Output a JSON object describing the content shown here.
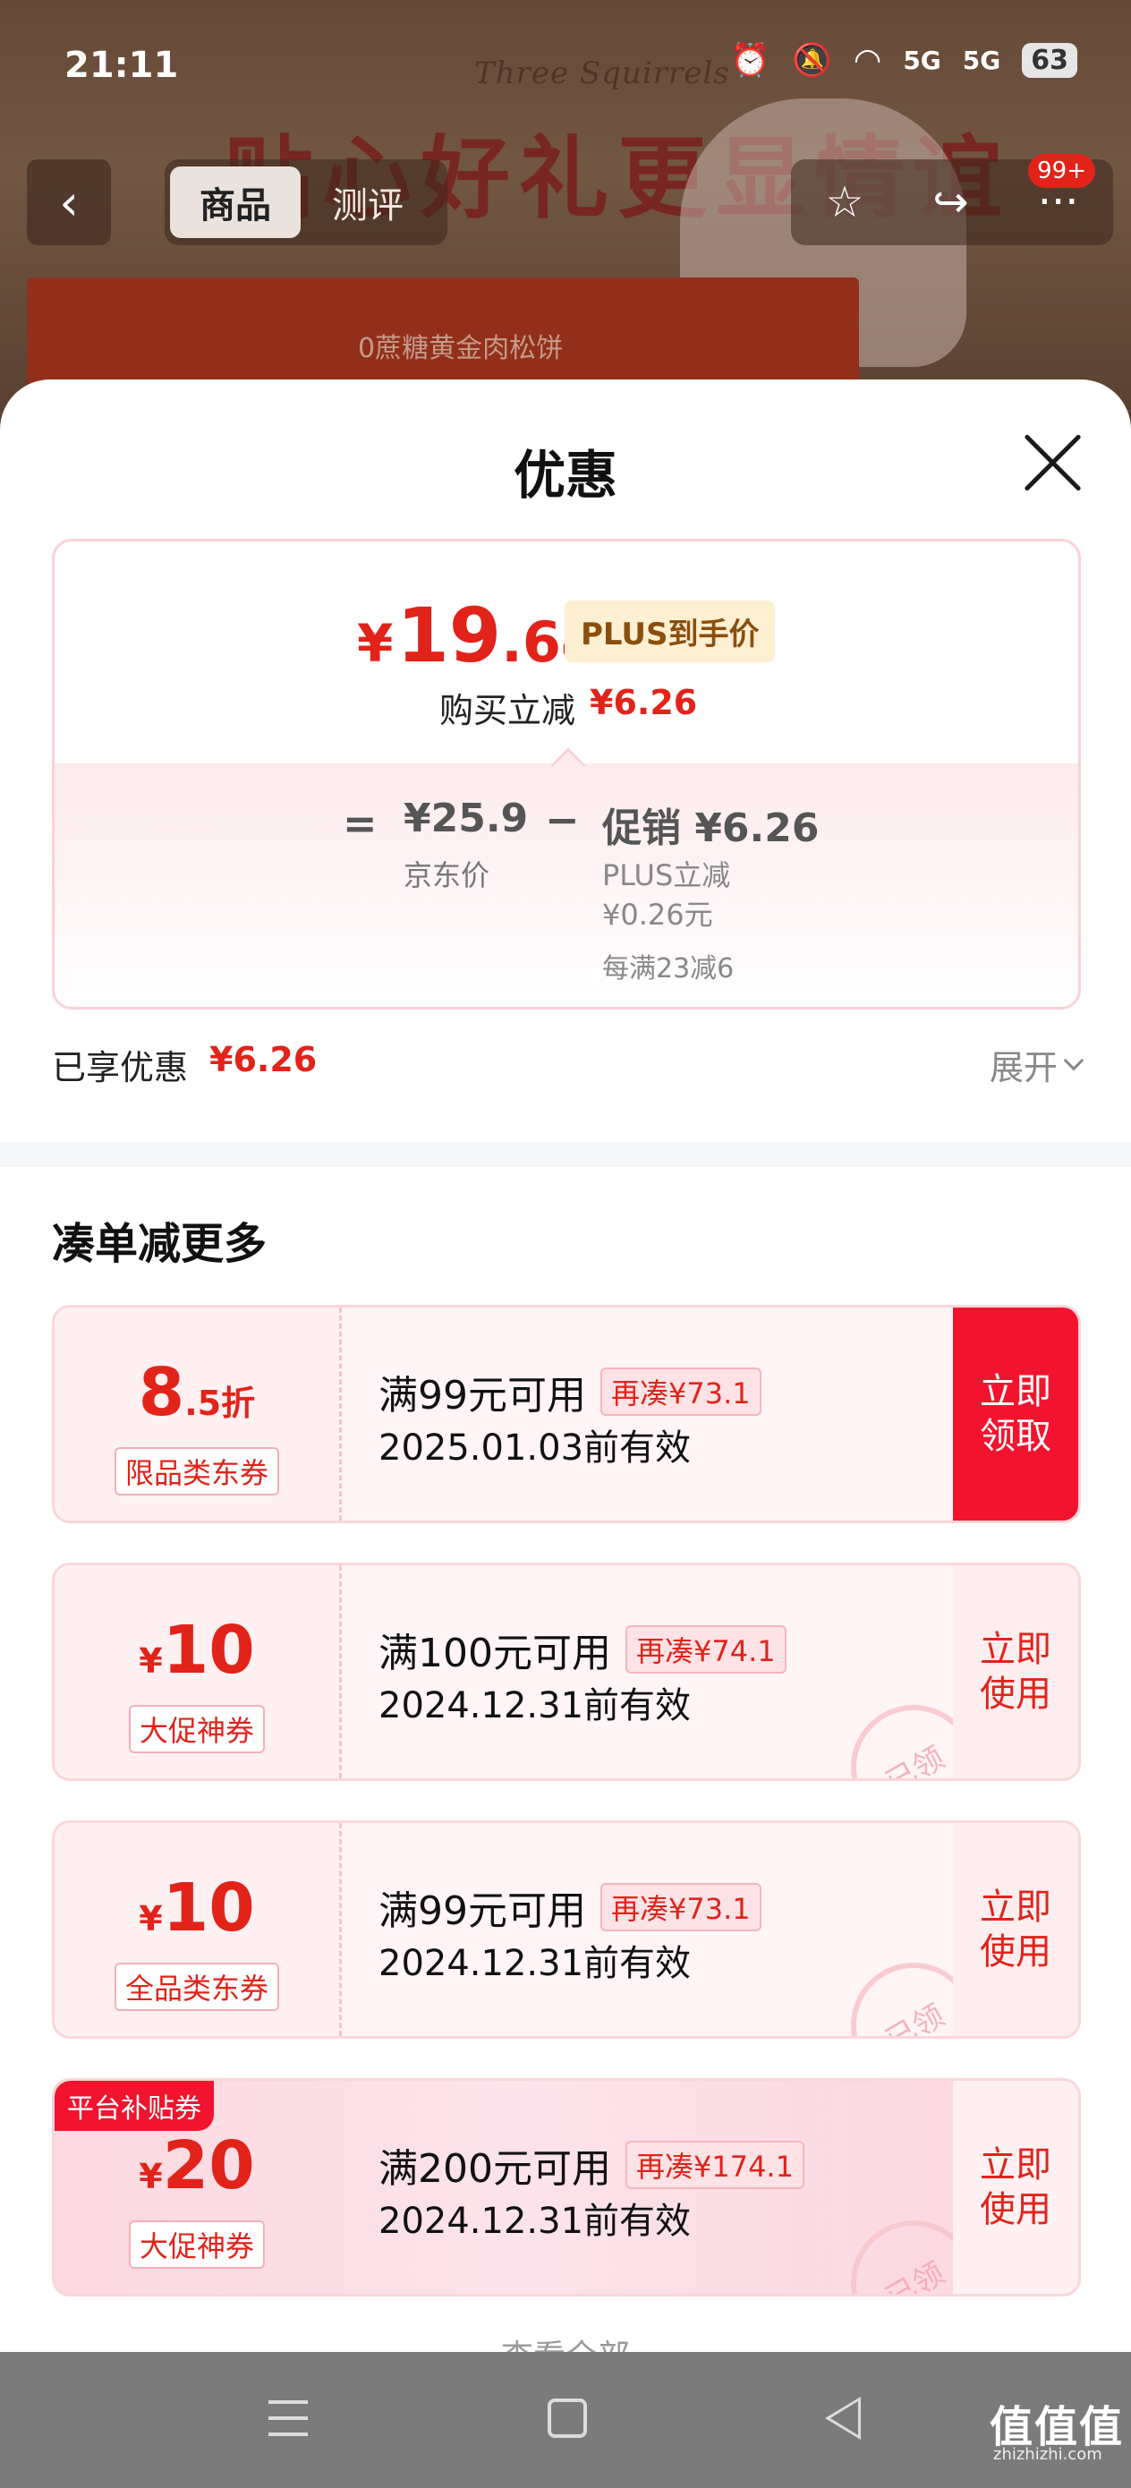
{
  "status_bar": {
    "time": "21:11",
    "network_1": "5G",
    "network_2": "5G",
    "battery": "63"
  },
  "background": {
    "brand_watermark": "Three Squirrels",
    "headline": "贴心好礼更显情谊",
    "product_label": "0蔗糖黄金肉松饼"
  },
  "nav": {
    "tabs": [
      {
        "label": "商品"
      },
      {
        "label": "测评"
      }
    ],
    "badge": "99+"
  },
  "sheet": {
    "title": "优惠",
    "final_price": {
      "currency": "¥",
      "integer": "19",
      "decimal": ".64"
    },
    "plus_tag": "PLUS到手价",
    "instant_reduce_label": "购买立减",
    "instant_reduce_amount": "¥6.26",
    "breakdown": {
      "eq": "=",
      "jd_price": "¥25.9",
      "jd_label": "京东价",
      "minus": "−",
      "promo_label": "促销 ¥6.26",
      "plus_reduce": "PLUS立减",
      "plus_reduce_amount": "¥0.26元",
      "rule": "每满23减6"
    },
    "enjoyed_label": "已享优惠",
    "enjoyed_amount": "¥6.26",
    "expand_label": "展开",
    "section_title": "凑单减更多",
    "coupons": [
      {
        "big": "8",
        "small": ".5折",
        "prefix": "",
        "type": "限品类东券",
        "condition": "满99元可用",
        "need": "再凑¥73.1",
        "date": "2025.01.03前有效",
        "action": "立即领取",
        "stamp": ""
      },
      {
        "big": "10",
        "small": "",
        "prefix": "¥",
        "type": "大促神券",
        "condition": "满100元可用",
        "need": "再凑¥74.1",
        "date": "2024.12.31前有效",
        "action": "立即使用",
        "stamp": "已领"
      },
      {
        "big": "10",
        "small": "",
        "prefix": "¥",
        "type": "全品类东券",
        "condition": "满99元可用",
        "need": "再凑¥73.1",
        "date": "2024.12.31前有效",
        "action": "立即使用",
        "stamp": "已领"
      },
      {
        "big": "20",
        "small": "",
        "prefix": "¥",
        "type": "大促神券",
        "condition": "满200元可用",
        "need": "再凑¥174.1",
        "date": "2024.12.31前有效",
        "action": "立即使用",
        "stamp": "已领",
        "tag": "平台补贴券"
      }
    ],
    "view_all": "查看全部"
  },
  "watermark": {
    "text": "值值值",
    "sub": "zhizhizhi.com"
  },
  "colors": {
    "accent": "#e2231a",
    "coupon_border": "#fbd6da",
    "plus_tag_bg": "#fdf0d2"
  }
}
